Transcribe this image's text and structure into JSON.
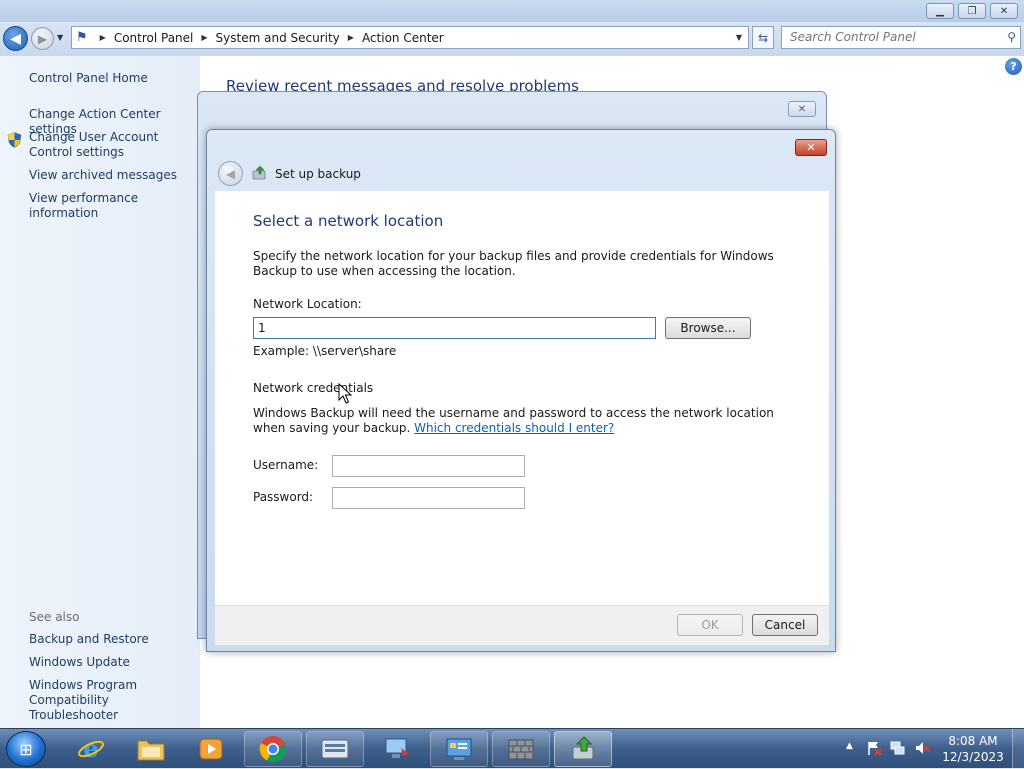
{
  "window": {
    "breadcrumbs": [
      "Control Panel",
      "System and Security",
      "Action Center"
    ],
    "search_placeholder": "Search Control Panel"
  },
  "sidebar": {
    "home": "Control Panel Home",
    "items": [
      "Change Action Center settings",
      "Change User Account Control settings",
      "View archived messages",
      "View performance information"
    ],
    "see_also_label": "See also",
    "see_also": [
      "Backup and Restore",
      "Windows Update",
      "Windows Program Compatibility Troubleshooter"
    ]
  },
  "main": {
    "title": "Review recent messages and resolve problems"
  },
  "dialog": {
    "title": "Set up backup",
    "heading": "Select a network location",
    "description": "Specify the network location for your backup files and provide credentials for Windows Backup to use when accessing the location.",
    "network_location_label": "Network Location:",
    "network_location_value": "1",
    "browse_label": "Browse...",
    "example_text": "Example: \\\\server\\share",
    "credentials_heading": "Network credentials",
    "credentials_text": "Windows Backup will need the username and password to access the network location when saving your backup.",
    "credentials_link": "Which credentials should I enter?",
    "username_label": "Username:",
    "password_label": "Password:",
    "username_value": "",
    "password_value": "",
    "ok_label": "OK",
    "cancel_label": "Cancel"
  },
  "taskbar": {
    "apps": [
      {
        "name": "Internet Explorer",
        "icon": "ie-icon"
      },
      {
        "name": "Windows Explorer",
        "icon": "folder-icon"
      },
      {
        "name": "Windows Media Player",
        "icon": "media-player-icon"
      },
      {
        "name": "Google Chrome",
        "icon": "chrome-icon"
      },
      {
        "name": "On-Screen Keyboard",
        "icon": "keyboard-icon"
      },
      {
        "name": "Remote Desktop",
        "icon": "remote-desktop-icon"
      },
      {
        "name": "Control Panel",
        "icon": "control-panel-icon"
      },
      {
        "name": "Windows Firewall",
        "icon": "firewall-icon"
      },
      {
        "name": "Backup and Restore",
        "icon": "backup-icon"
      }
    ],
    "time": "8:08 AM",
    "date": "12/3/2023"
  },
  "colors": {
    "heading_blue": "#1e3a74",
    "link_blue": "#0a62b8",
    "sidebar_bg": "#eef4fb",
    "taskbar_blue": "#3e5f8c"
  }
}
